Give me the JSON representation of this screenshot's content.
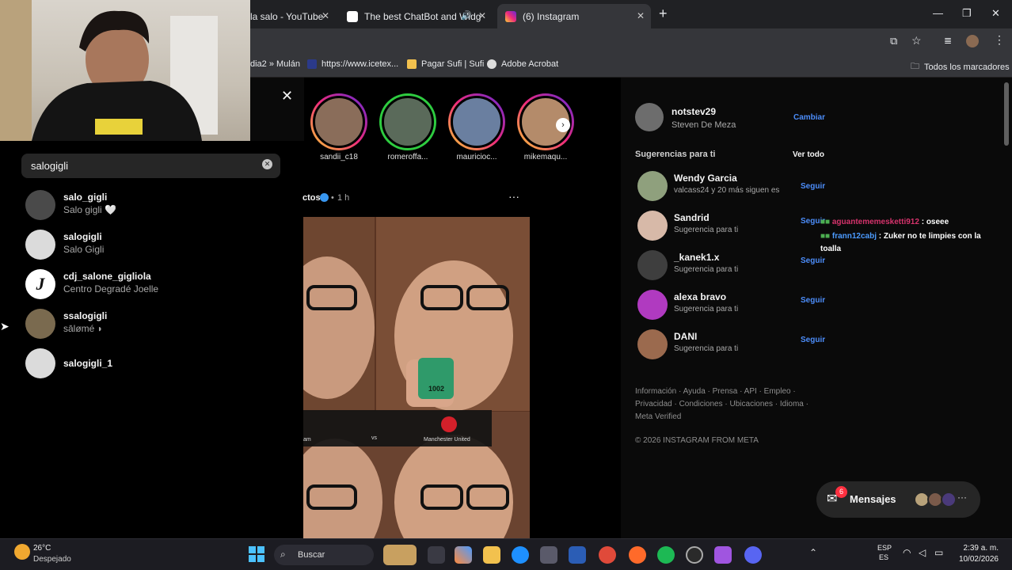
{
  "browser": {
    "tabs": [
      {
        "title": "la salo - YouTube",
        "active": false
      },
      {
        "title": "The best ChatBot and Widg",
        "active": false
      },
      {
        "title": "(6) Instagram",
        "active": true
      }
    ],
    "new_tab": "+",
    "bookmarks": [
      "dia2 » Mulán",
      "https://www.icetex...",
      "Pagar Sufi | Sufi",
      "Adobe Acrobat"
    ],
    "all_bookmarks": "Todos los marcadores"
  },
  "search": {
    "query": "salogigli",
    "results": [
      {
        "username": "salo_gigli",
        "name": "Salo gigli 🤍"
      },
      {
        "username": "salogigli",
        "name": "Salo Gigli"
      },
      {
        "username": "cdj_salone_gigliola",
        "name": "Centro Degradé Joelle",
        "avatar_letter": "J"
      },
      {
        "username": "ssalogigli",
        "name": "sālømé ◗"
      },
      {
        "username": "salogigli_1",
        "name": ""
      }
    ]
  },
  "stories": [
    "sandii_c18",
    "romeroffa...",
    "mauricioc...",
    "mikemaqu..."
  ],
  "post": {
    "author_suffix": "ctos",
    "time": "1 h",
    "more": "···",
    "scoreboard": {
      "left": "am",
      "vs": "vs",
      "right": "Manchester United"
    },
    "counter": "1002"
  },
  "profile": {
    "username": "notstev29",
    "name": "Steven De Meza",
    "switch": "Cambiar"
  },
  "suggestions": {
    "title": "Sugerencias para ti",
    "see_all": "Ver todo",
    "follow_label": "Seguir",
    "items": [
      {
        "username": "Wendy Garcia",
        "subtitle": "valcass24 y 20 más siguen es"
      },
      {
        "username": "Sandrid",
        "subtitle": "Sugerencia para ti"
      },
      {
        "username": "_kanek1.x",
        "subtitle": "Sugerencia para ti"
      },
      {
        "username": "alexa bravo",
        "subtitle": "Sugerencia para ti"
      },
      {
        "username": "DANI",
        "subtitle": "Sugerencia para ti"
      }
    ]
  },
  "footer": {
    "line1": "Información · Ayuda · Prensa · API · Empleo ·",
    "line2": "Privacidad · Condiciones · Ubicaciones · Idioma ·",
    "line3": "Meta Verified",
    "copyright": "© 2026 INSTAGRAM FROM META"
  },
  "chat": [
    {
      "user": "aguantememesketti912",
      "message": ": oseee"
    },
    {
      "user": "frann12cabj",
      "message": ": Zuker no te limpies con la"
    },
    {
      "user": "",
      "message": "toalla"
    }
  ],
  "messages": {
    "label": "Mensajes",
    "badge": "6"
  },
  "taskbar": {
    "weather_temp": "26°C",
    "weather_desc": "Despejado",
    "search": "Buscar",
    "lang": "ESP",
    "lang2": "ES",
    "time": "2:39 a. m.",
    "date": "10/02/2026"
  },
  "colors": {
    "accent_blue": "#4c8dfa",
    "chat_user1": "#d6336c",
    "chat_user2": "#4c9bff"
  }
}
